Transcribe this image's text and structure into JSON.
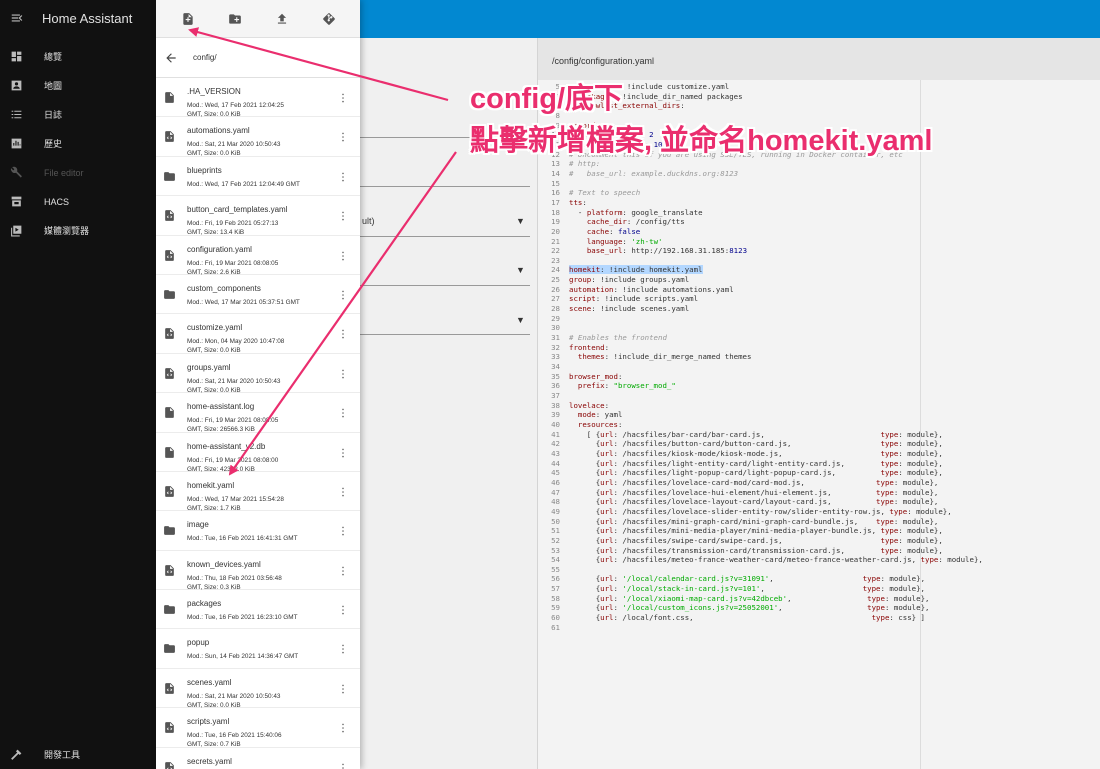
{
  "sidebar": {
    "title": "Home Assistant",
    "items": [
      {
        "label": "總覽",
        "icon": "dashboard-icon"
      },
      {
        "label": "地圖",
        "icon": "map-icon"
      },
      {
        "label": "日誌",
        "icon": "logbook-icon"
      },
      {
        "label": "歷史",
        "icon": "history-icon"
      },
      {
        "label": "File editor",
        "icon": "wrench-icon"
      },
      {
        "label": "HACS",
        "icon": "hacs-icon"
      },
      {
        "label": "媒體瀏覽器",
        "icon": "media-icon"
      }
    ],
    "bottom_label": "開發工具"
  },
  "file_browser": {
    "path": "config/",
    "files": [
      {
        "name": ".HA_VERSION",
        "type": "file",
        "modified": "Mod.: Wed, 17 Feb 2021 12:04:25",
        "size": "GMT, Size: 0.0 KiB"
      },
      {
        "name": "automations.yaml",
        "type": "code",
        "modified": "Mod.: Sat, 21 Mar 2020 10:50:43",
        "size": "GMT, Size: 0.0 KiB"
      },
      {
        "name": "blueprints",
        "type": "folder",
        "modified": "Mod.: Wed, 17 Feb 2021 12:04:49 GMT",
        "size": ""
      },
      {
        "name": "button_card_templates.yaml",
        "type": "code",
        "modified": "Mod.: Fri, 19 Feb 2021 05:27:13",
        "size": "GMT, Size: 13.4 KiB"
      },
      {
        "name": "configuration.yaml",
        "type": "code",
        "modified": "Mod.: Fri, 19 Mar 2021 08:08:05",
        "size": "GMT, Size: 2.6 KiB"
      },
      {
        "name": "custom_components",
        "type": "folder",
        "modified": "Mod.: Wed, 17 Mar 2021 05:37:51 GMT",
        "size": ""
      },
      {
        "name": "customize.yaml",
        "type": "code",
        "modified": "Mod.: Mon, 04 May 2020 10:47:08",
        "size": "GMT, Size: 0.0 KiB"
      },
      {
        "name": "groups.yaml",
        "type": "code",
        "modified": "Mod.: Sat, 21 Mar 2020 10:50:43",
        "size": "GMT, Size: 0.0 KiB"
      },
      {
        "name": "home-assistant.log",
        "type": "file",
        "modified": "Mod.: Fri, 19 Mar 2021 08:08:05",
        "size": "GMT, Size: 26566.3 KiB"
      },
      {
        "name": "home-assistant_v2.db",
        "type": "file",
        "modified": "Mod.: Fri, 19 Mar 2021 08:08:00",
        "size": "GMT, Size: 42332.0 KiB"
      },
      {
        "name": "homekit.yaml",
        "type": "code",
        "modified": "Mod.: Wed, 17 Mar 2021 15:54:28",
        "size": "GMT, Size: 1.7 KiB"
      },
      {
        "name": "image",
        "type": "folder",
        "modified": "Mod.: Tue, 16 Feb 2021 16:41:31 GMT",
        "size": ""
      },
      {
        "name": "known_devices.yaml",
        "type": "code",
        "modified": "Mod.: Thu, 18 Feb 2021 03:56:48",
        "size": "GMT, Size: 0.3 KiB"
      },
      {
        "name": "packages",
        "type": "folder",
        "modified": "Mod.: Tue, 16 Feb 2021 16:23:10 GMT",
        "size": ""
      },
      {
        "name": "popup",
        "type": "folder",
        "modified": "Mod.: Sun, 14 Feb 2021 14:36:47 GMT",
        "size": ""
      },
      {
        "name": "scenes.yaml",
        "type": "code",
        "modified": "Mod.: Sat, 21 Mar 2020 10:50:43",
        "size": "GMT, Size: 0.0 KiB"
      },
      {
        "name": "scripts.yaml",
        "type": "code",
        "modified": "Mod.: Tue, 16 Feb 2021 15:40:06",
        "size": "GMT, Size: 0.7 KiB"
      },
      {
        "name": "secrets.yaml",
        "type": "code",
        "modified": "",
        "size": ""
      }
    ]
  },
  "editor": {
    "path": "/config/configuration.yaml",
    "fragment": "ult)"
  },
  "annotation": {
    "line1": "config/底下",
    "line2": "點擊新增檔案, 並命名homekit.yaml"
  },
  "colors": {
    "header": "#0288d1",
    "annotation": "#ea2e6e",
    "sidebar": "#111111"
  }
}
